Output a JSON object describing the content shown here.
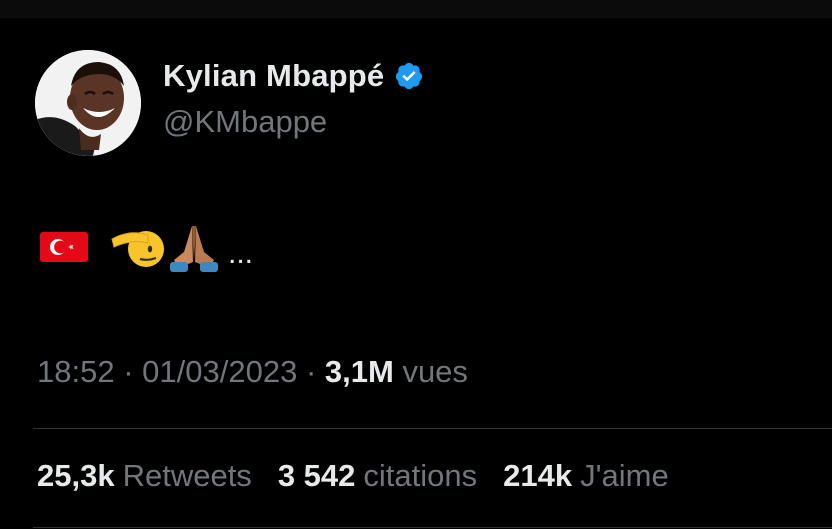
{
  "author": {
    "display_name": "Kylian Mbappé",
    "handle": "@KMbappe",
    "verified_color": "#1d9bf0"
  },
  "tweet": {
    "emojis": [
      "turkey-flag",
      "saluting-face",
      "folded-hands"
    ],
    "trailing_text": "..."
  },
  "meta": {
    "time": "18:52",
    "separator": "·",
    "date": "01/03/2023",
    "views_count": "3,1M",
    "views_label": "vues"
  },
  "stats": {
    "retweets_count": "25,3k",
    "retweets_label": "Retweets",
    "quotes_count": "3 542",
    "quotes_label": "citations",
    "likes_count": "214k",
    "likes_label": "J'aime"
  }
}
